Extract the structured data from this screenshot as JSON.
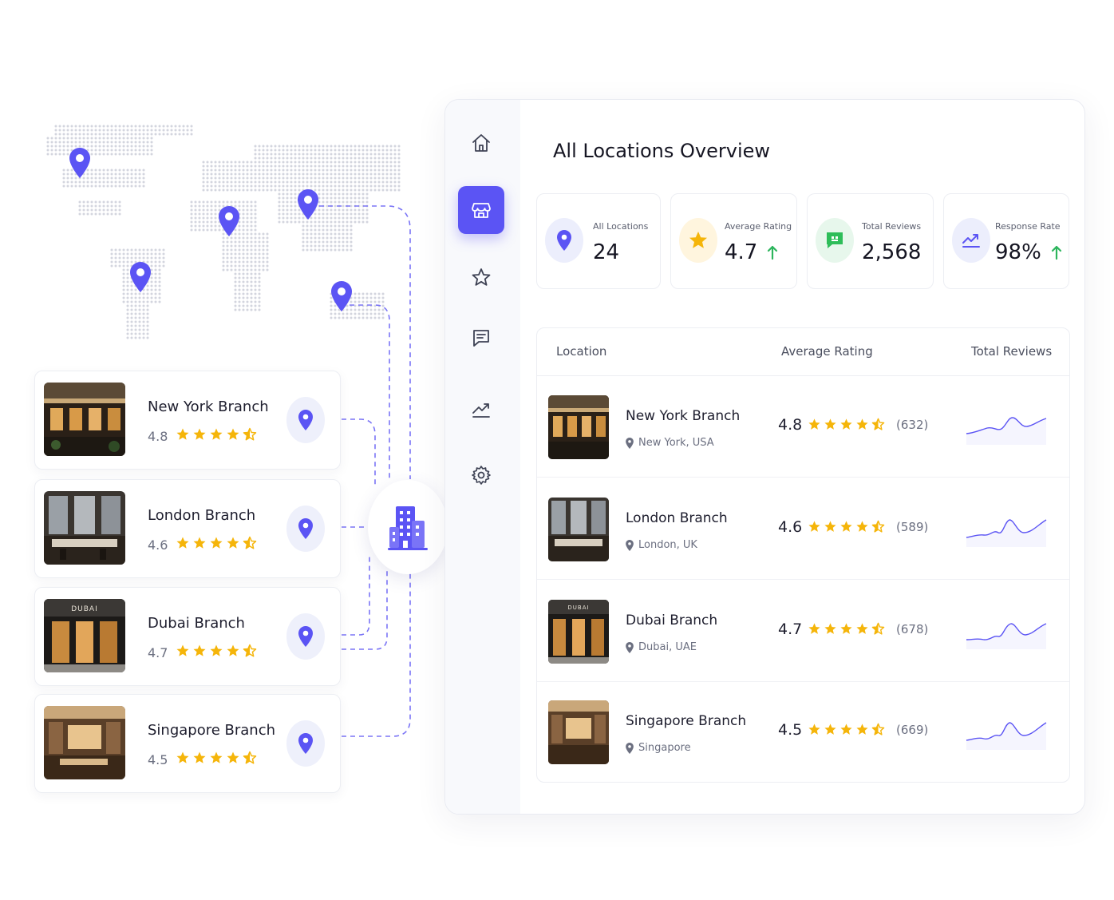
{
  "branches": [
    {
      "name": "New York Branch",
      "rating": "4.8",
      "stars": 4.5,
      "city": "New York, USA",
      "reviews": "(632)"
    },
    {
      "name": "London Branch",
      "rating": "4.6",
      "stars": 4.5,
      "city": "London, UK",
      "reviews": "(589)"
    },
    {
      "name": "Dubai Branch",
      "rating": "4.7",
      "stars": 4.5,
      "city": "Dubai, UAE",
      "reviews": "(678)",
      "sign": "DUBAI"
    },
    {
      "name": "Singapore Branch",
      "rating": "4.5",
      "stars": 4.5,
      "city": "Singapore",
      "reviews": "(669)"
    }
  ],
  "sidebar": {
    "items": [
      "home-icon",
      "store-icon",
      "star-icon",
      "reviews-icon",
      "analytics-icon",
      "settings-icon"
    ],
    "active": "store-icon"
  },
  "dashboard": {
    "title": "All Locations Overview",
    "stats": [
      {
        "label": "All Locations",
        "value": "24",
        "icon": "location-pin-icon",
        "trend": false
      },
      {
        "label": "Average Rating",
        "value": "4.7",
        "icon": "star-icon",
        "trend": true
      },
      {
        "label": "Total Reviews",
        "value": "2,568",
        "icon": "chat-icon",
        "trend": false
      },
      {
        "label": "Response Rate",
        "value": "98%",
        "icon": "trend-icon",
        "trend": true
      }
    ],
    "table": {
      "headers": {
        "location": "Location",
        "rating": "Average Rating",
        "reviews": "Total Reviews"
      }
    }
  },
  "colors": {
    "accent": "#5b54f4",
    "star": "#f5b50a",
    "trend_up": "#2db55d",
    "review_green": "#2ebd59"
  }
}
